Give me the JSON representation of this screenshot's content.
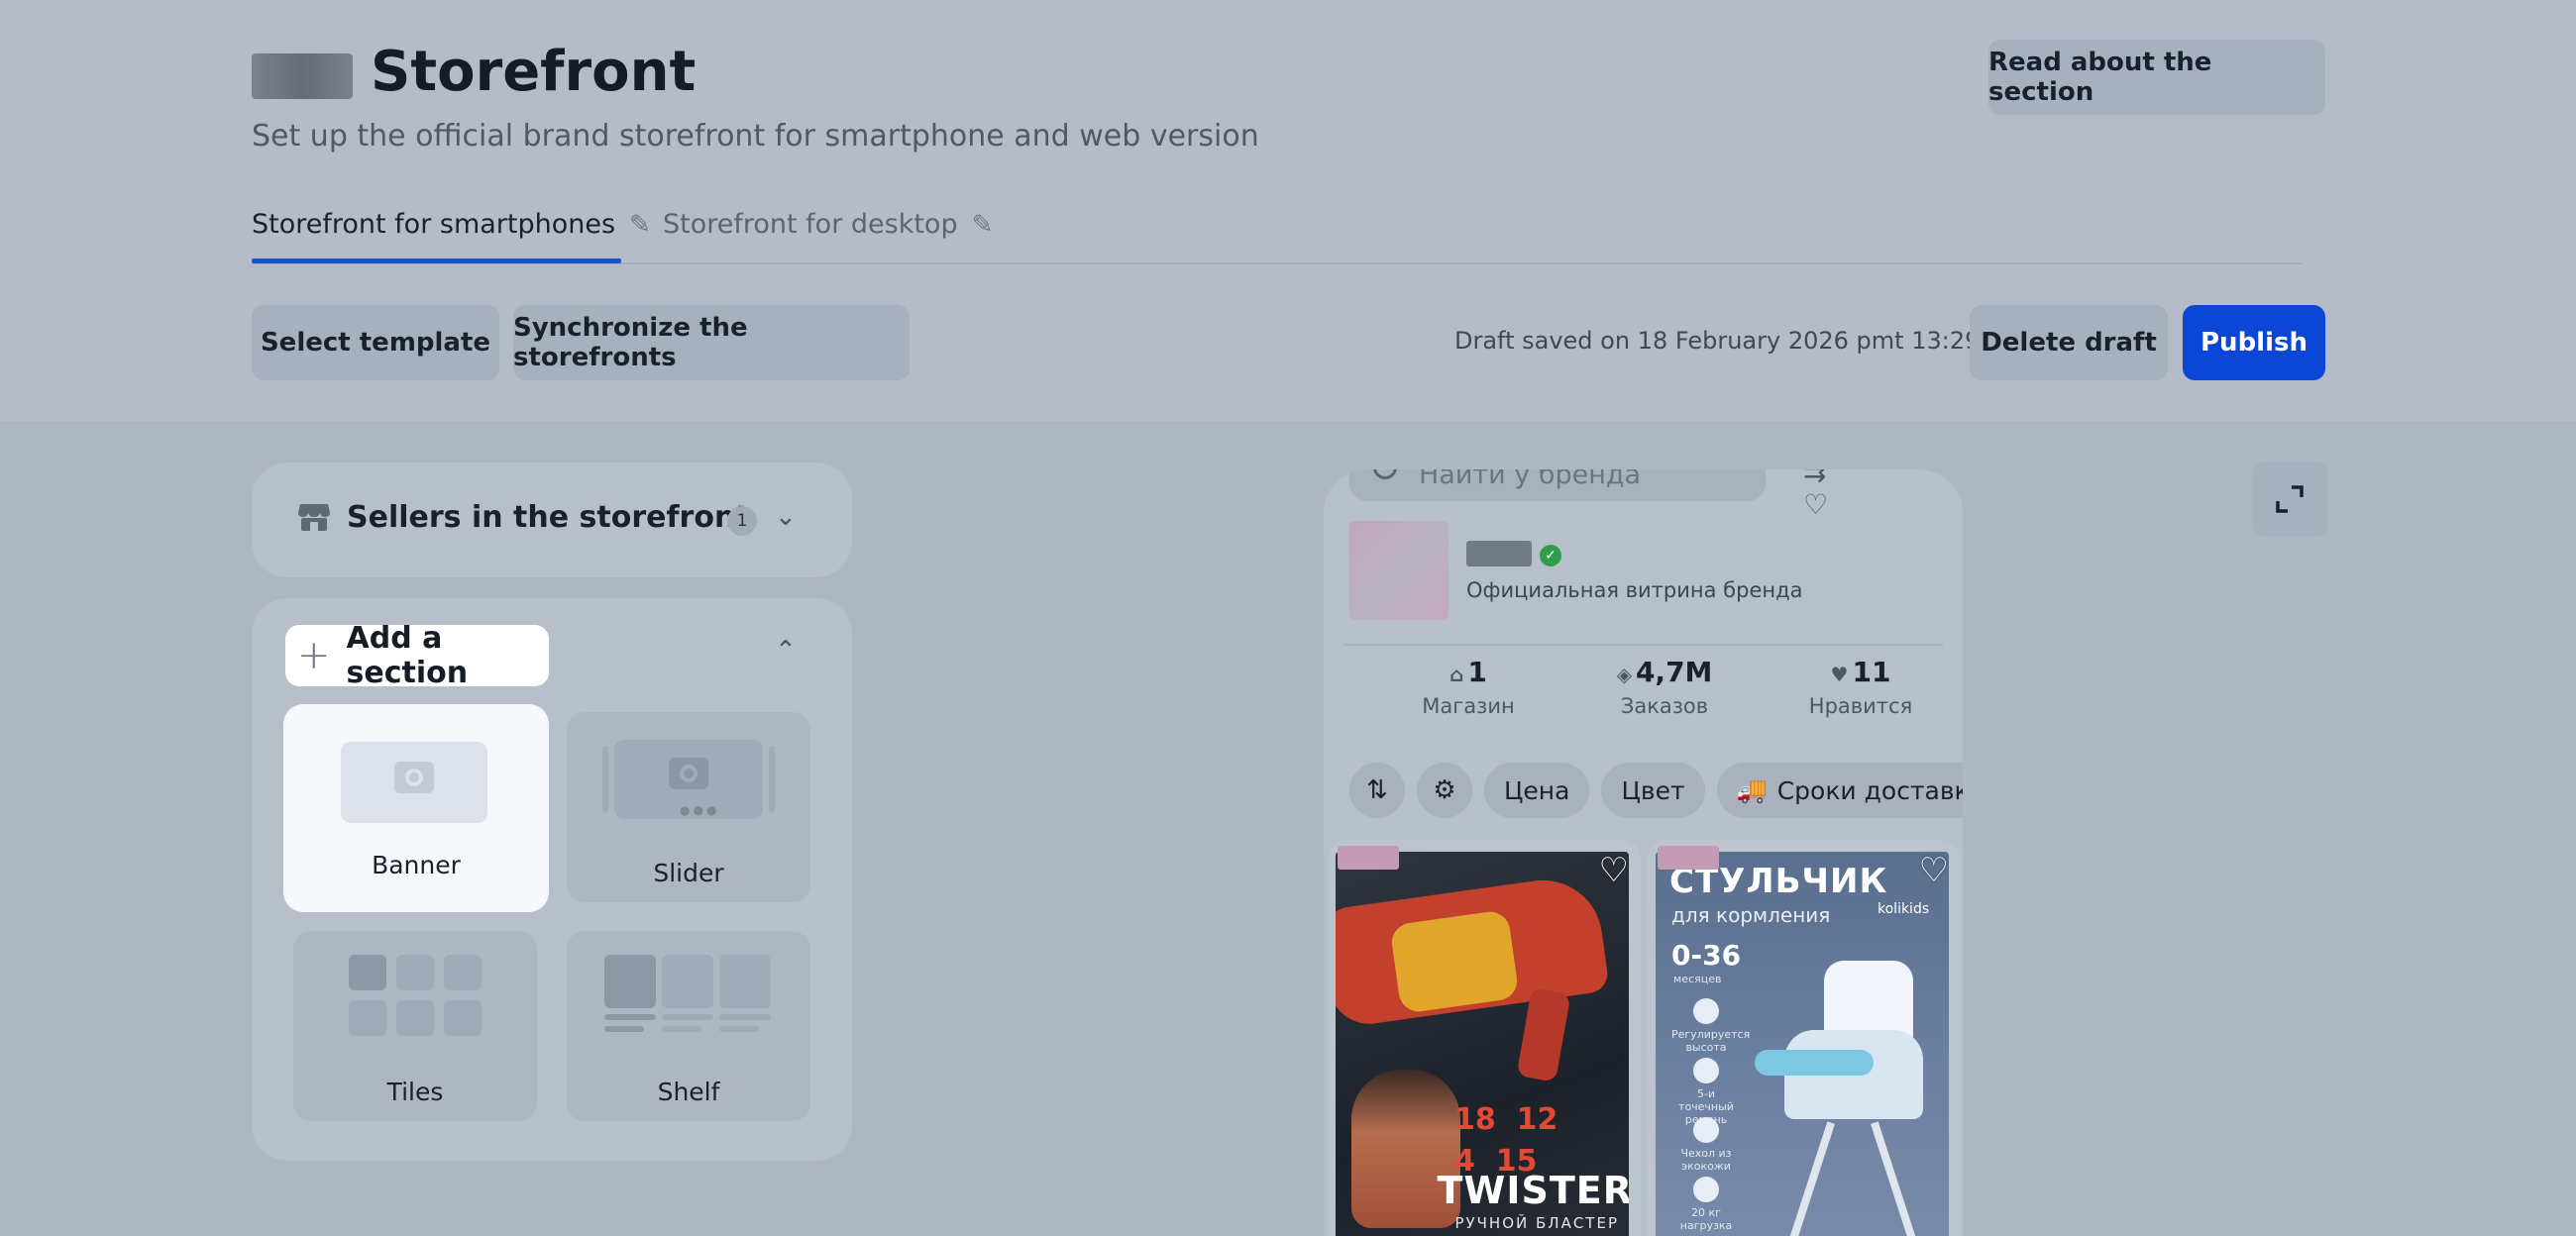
{
  "header": {
    "title": "Storefront",
    "subtitle": "Set up the official brand storefront for smartphone and web version",
    "read_button": "Read about the section"
  },
  "tabs": [
    {
      "label": "Storefront for smartphones",
      "active": true
    },
    {
      "label": "Storefront for desktop",
      "active": false
    }
  ],
  "toolbar": {
    "select_template": "Select template",
    "synchronize": "Synchronize the storefronts",
    "draft_status": "Draft saved on 18 February 2026 pmt 13:29",
    "delete_draft": "Delete draft",
    "publish": "Publish"
  },
  "sellers": {
    "title": "Sellers in the storefront",
    "count": "1"
  },
  "sections": {
    "add_label": "Add a section",
    "items": [
      {
        "label": "Banner",
        "icon": "camera-icon"
      },
      {
        "label": "Slider",
        "icon": "camera-icon"
      },
      {
        "label": "Tiles",
        "icon": "grid-icon"
      },
      {
        "label": "Shelf",
        "icon": "shelf-icon"
      }
    ]
  },
  "preview": {
    "search_placeholder": "Найти у бренда",
    "brand_caption": "Официальная витрина бренда",
    "stats": [
      {
        "value": "1",
        "label": "Магазин",
        "icon": "store-icon"
      },
      {
        "value": "4,7M",
        "label": "Заказов",
        "icon": "box-icon"
      },
      {
        "value": "11",
        "label": "Нравится",
        "icon": "heart-icon"
      }
    ],
    "filters": {
      "price": "Цена",
      "color": "Цвет",
      "delivery": "Сроки доставки"
    },
    "products": [
      {
        "name": "TWISTER",
        "subtitle": "РУЧНОЙ БЛАСТЕР",
        "stat_a": "18",
        "stat_b": "12",
        "stat_c": "4",
        "stat_d": "15"
      },
      {
        "title": "СТУЛЬЧИК",
        "subtitle": "для кормления",
        "brand": "kolikids",
        "age": "0-36",
        "age_unit": "месяцев",
        "features": [
          "Регулируется высота",
          "5-и точечный ремень",
          "Чехол из экокожи",
          "20 кг нагрузка"
        ]
      }
    ]
  },
  "colors": {
    "accent": "#0b46d6",
    "tab_underline": "#1a55c8",
    "verified": "#2e9e4e"
  }
}
